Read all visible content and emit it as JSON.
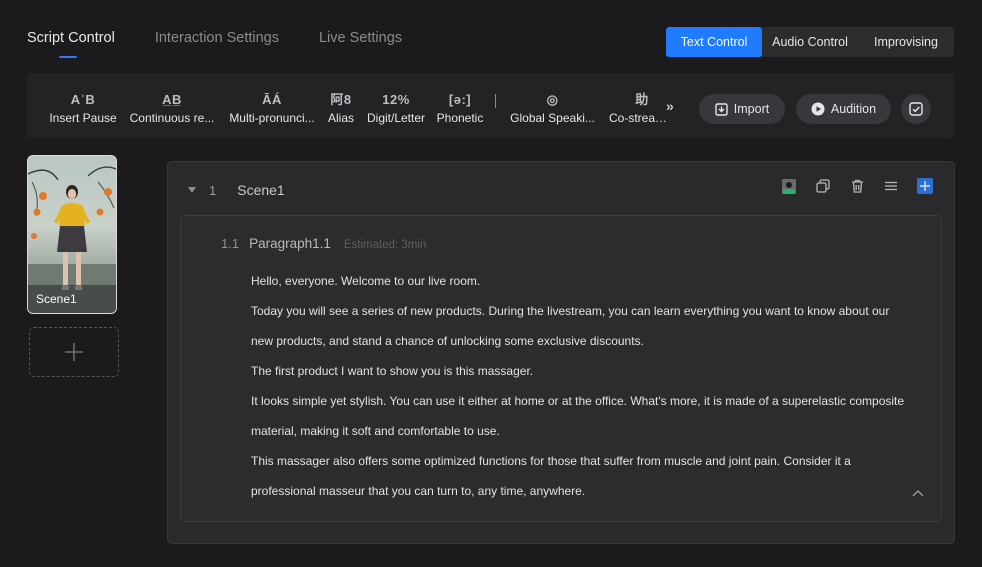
{
  "tabs": [
    "Script Control",
    "Interaction Settings",
    "Live Settings"
  ],
  "mode_switch": [
    "Text Control",
    "Audio Control",
    "Improvising"
  ],
  "toolbar": {
    "tools": [
      {
        "icon_text": "AˈB",
        "label": "Insert Pause"
      },
      {
        "icon_text": "A̲B̲",
        "label": "Continuous re..."
      },
      {
        "icon_text": "ĀÁ",
        "label": "Multi-pronunci..."
      },
      {
        "icon_text": "阿8",
        "label": "Alias"
      },
      {
        "icon_text": "12%",
        "label": "Digit/Letter"
      },
      {
        "icon_text": "[ə:]",
        "label": "Phonetic"
      },
      {
        "icon_text": "◎",
        "label": "Global Speaki..."
      },
      {
        "icon_text": "助",
        "label": "Co-streamer"
      }
    ],
    "more_symbol": "»",
    "import_label": "Import",
    "audition_label": "Audition"
  },
  "scenes_list": {
    "thumb_name": "Scene1"
  },
  "scene": {
    "number": "1",
    "title": "Scene1",
    "paragraph": {
      "number": "1.1",
      "title": "Paragraph1.1",
      "estimated": "Estimated: 3min",
      "lines": [
        "Hello, everyone. Welcome to our live room.",
        "Today you will see a series of new products. During the livestream, you can learn everything you want to know about our",
        "new products, and stand a chance of unlocking some exclusive discounts.",
        "The first product I want to show you is this massager.",
        "It looks simple yet stylish. You can use it either at home or at the office. What's more, it is made of a superelastic composite",
        "material, making it soft and comfortable to use.",
        "This massager also offers some optimized functions for those that suffer from muscle and joint pain. Consider it a",
        "professional masseur that you can turn to, any time, anywhere."
      ]
    }
  },
  "colors": {
    "accent": "#1f7bff",
    "background": "#1b1b1d",
    "panel": "#232326"
  }
}
